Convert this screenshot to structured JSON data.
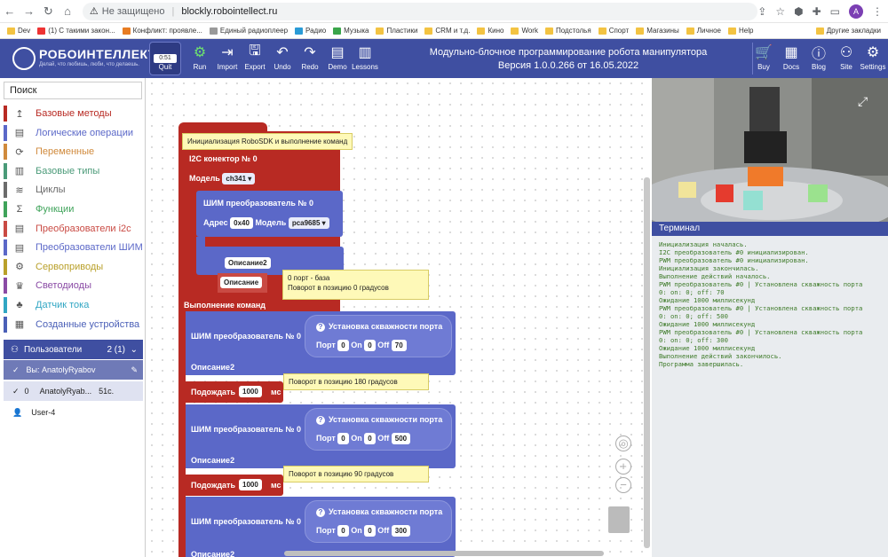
{
  "browser": {
    "security": "Не защищено",
    "url": "blockly.robointellect.ru",
    "profile_initial": "A"
  },
  "bookmarks": [
    "Dev",
    "(1) С такими закон...",
    "Конфликт: проявле...",
    "Единый радиоплеер",
    "Радио",
    "Музыка",
    "Пластики",
    "CRM и т.д.",
    "Кино",
    "Work",
    "Подстолья",
    "Спорт",
    "Магазины",
    "Личное",
    "Help"
  ],
  "bookmarks_end": "Другие закладки",
  "appbar": {
    "logo_title": "РОБОИНТЕЛЛЕКТ",
    "logo_sub": "Делай, что любишь, люби, что делаешь.",
    "quit_label": "Quit",
    "timer": "0:51",
    "tools": [
      "Run",
      "Import",
      "Export",
      "Undo",
      "Redo",
      "Demo",
      "Lessons"
    ],
    "title_line1": "Модульно-блочное программирование робота манипулятора",
    "title_line2": "Версия 1.0.0.266 от 16.05.2022",
    "right_tools": [
      "Buy",
      "Docs",
      "Blog",
      "Site",
      "Settings"
    ]
  },
  "sidebar": {
    "search": "Поиск",
    "categories": [
      {
        "label": "Базовые методы",
        "color": "#b82a23"
      },
      {
        "label": "Логические операции",
        "color": "#5b68c8"
      },
      {
        "label": "Переменные",
        "color": "#d08a3c"
      },
      {
        "label": "Базовые типы",
        "color": "#4a9a78"
      },
      {
        "label": "Циклы",
        "color": "#6b6b6b"
      },
      {
        "label": "Функции",
        "color": "#3fa35a"
      },
      {
        "label": "Преобразователи i2c",
        "color": "#c94a43"
      },
      {
        "label": "Преобразователи ШИМ",
        "color": "#5b68c8"
      },
      {
        "label": "Сервоприводы",
        "color": "#b9a02a"
      },
      {
        "label": "Светодиоды",
        "color": "#8a4ba5"
      },
      {
        "label": "Датчик тока",
        "color": "#30a6c3"
      },
      {
        "label": "Созданные устройства",
        "color": "#4a5fb7"
      }
    ],
    "users_label": "Пользователи",
    "users_count": "2 (1)",
    "me": "Вы: AnatolyRyabov",
    "sel_idx": "0",
    "sel_name": "AnatolyRyab...",
    "sel_time": "51с.",
    "other": "User-4"
  },
  "blocks": {
    "init_tip": "Инициализация RoboSDK и выполнение команд",
    "init_partial": "Инициализация",
    "i2c": "I2C конектор №",
    "i2c_num": "0",
    "model": "Модель",
    "model_val": "ch341",
    "pwm_conv": "ШИМ преобразователь №",
    "pwm_num": "0",
    "addr": "Адрес",
    "addr_val": "0x40",
    "model2_val": "pca9685",
    "desc2": "Описание2",
    "desc": "Описание",
    "exec": "Выполнение команд",
    "pwm1": "ШИМ преобразователь №",
    "pwm1_num": "0",
    "set_duty": "Установка скважности порта",
    "port": "Порт",
    "on": "On",
    "off": "Off",
    "p1": "0",
    "on1": "0",
    "off1": "70",
    "tip1a": "0 порт - база",
    "tip1b": "Поворот в позицию 0 градусов",
    "wait": "Подождать",
    "ms": "мс",
    "wait1": "1000",
    "tip2": "Поворот в позицию 180 градусов",
    "p2": "0",
    "on2": "0",
    "off2": "500",
    "wait2": "1000",
    "tip3": "Поворот в позицию 90 градусов",
    "p3": "0",
    "on3": "0",
    "off3": "300"
  },
  "terminal": {
    "title": "Терминал",
    "lines": [
      "Инициализация началась.",
      "I2C преобразователь #0 инициализирован.",
      "PWM преобразователь #0 инициализирован.",
      "Инициализация закончилась.",
      "Выполнение действий началось.",
      "PWM преобразователь #0 | Установлена скважность порта",
      "0: on: 0; off: 70",
      "Ожидание 1000 миллисекунд",
      "PWM преобразователь #0 | Установлена скважность порта",
      "0: on: 0; off: 500",
      "Ожидание 1000 миллисекунд",
      "PWM преобразователь #0 | Установлена скважность порта",
      "0: on: 0; off: 300",
      "Ожидание 1000 миллисекунд",
      "Выполнение действий закончилось.",
      "Программа завершилась."
    ]
  }
}
